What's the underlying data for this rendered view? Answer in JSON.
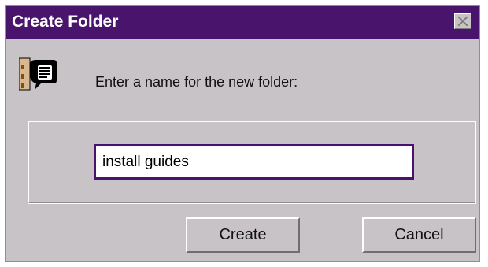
{
  "window": {
    "title": "Create Folder",
    "title_bar_color": "#49146b",
    "close_icon": "close-icon"
  },
  "prompt": {
    "icon": "folder-prompt-icon",
    "text": "Enter a name for the new folder:"
  },
  "folder_name_input": {
    "value": "install guides"
  },
  "buttons": {
    "create_label": "Create",
    "cancel_label": "Cancel"
  }
}
